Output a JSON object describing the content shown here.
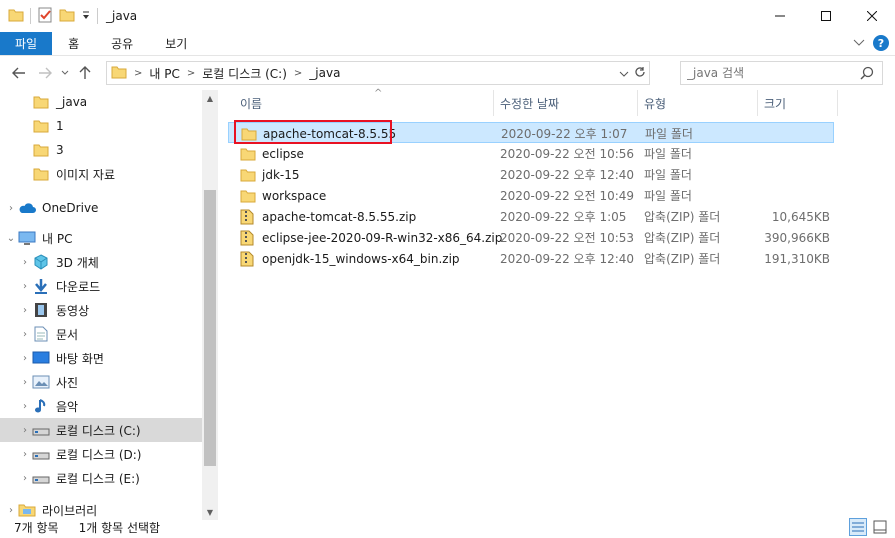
{
  "window": {
    "title": "_java"
  },
  "ribbon": {
    "tabs": [
      "파일",
      "홈",
      "공유",
      "보기"
    ]
  },
  "address": {
    "crumbs": [
      "내 PC",
      "로컬 디스크 (C:)",
      "_java"
    ]
  },
  "search": {
    "placeholder": "_java 검색"
  },
  "nav": {
    "items": [
      {
        "label": "_java",
        "icon": "folder-icon",
        "indent": 1,
        "expander": ""
      },
      {
        "label": "1",
        "icon": "folder-icon",
        "indent": 1,
        "expander": ""
      },
      {
        "label": "3",
        "icon": "folder-icon",
        "indent": 1,
        "expander": ""
      },
      {
        "label": "이미지 자료",
        "icon": "folder-icon",
        "indent": 1,
        "expander": ""
      },
      {
        "label": "OneDrive",
        "icon": "cloud-icon",
        "indent": 0,
        "expander": ">"
      },
      {
        "label": "내 PC",
        "icon": "computer-icon",
        "indent": 0,
        "expander": "v"
      },
      {
        "label": "3D 개체",
        "icon": "cube-icon",
        "indent": 1,
        "expander": ">"
      },
      {
        "label": "다운로드",
        "icon": "download-icon",
        "indent": 1,
        "expander": ">"
      },
      {
        "label": "동영상",
        "icon": "film-icon",
        "indent": 1,
        "expander": ">"
      },
      {
        "label": "문서",
        "icon": "document-icon",
        "indent": 1,
        "expander": ">"
      },
      {
        "label": "바탕 화면",
        "icon": "desktop-icon",
        "indent": 1,
        "expander": ">"
      },
      {
        "label": "사진",
        "icon": "picture-icon",
        "indent": 1,
        "expander": ">"
      },
      {
        "label": "음악",
        "icon": "music-icon",
        "indent": 1,
        "expander": ">"
      },
      {
        "label": "로컬 디스크 (C:)",
        "icon": "drive-icon",
        "indent": 1,
        "expander": ">",
        "selected": true
      },
      {
        "label": "로컬 디스크 (D:)",
        "icon": "drive-icon",
        "indent": 1,
        "expander": ">"
      },
      {
        "label": "로컬 디스크 (E:)",
        "icon": "drive-icon",
        "indent": 1,
        "expander": ">"
      },
      {
        "label": "라이브러리",
        "icon": "library-icon",
        "indent": 0,
        "expander": ">"
      }
    ]
  },
  "columns": {
    "name": "이름",
    "date": "수정한 날짜",
    "type": "유형",
    "size": "크기"
  },
  "files": [
    {
      "name": "apache-tomcat-8.5.55",
      "date": "2020-09-22 오후 1:07",
      "type": "파일 폴더",
      "size": "",
      "kind": "folder",
      "selected": true
    },
    {
      "name": "eclipse",
      "date": "2020-09-22 오전 10:56",
      "type": "파일 폴더",
      "size": "",
      "kind": "folder"
    },
    {
      "name": "jdk-15",
      "date": "2020-09-22 오후 12:40",
      "type": "파일 폴더",
      "size": "",
      "kind": "folder"
    },
    {
      "name": "workspace",
      "date": "2020-09-22 오전 10:49",
      "type": "파일 폴더",
      "size": "",
      "kind": "folder"
    },
    {
      "name": "apache-tomcat-8.5.55.zip",
      "date": "2020-09-22 오후 1:05",
      "type": "압축(ZIP) 폴더",
      "size": "10,645KB",
      "kind": "zip"
    },
    {
      "name": "eclipse-jee-2020-09-R-win32-x86_64.zip",
      "date": "2020-09-22 오전 10:53",
      "type": "압축(ZIP) 폴더",
      "size": "390,966KB",
      "kind": "zip"
    },
    {
      "name": "openjdk-15_windows-x64_bin.zip",
      "date": "2020-09-22 오후 12:40",
      "type": "압축(ZIP) 폴더",
      "size": "191,310KB",
      "kind": "zip"
    }
  ],
  "status": {
    "count": "7개 항목",
    "selected": "1개 항목 선택함"
  },
  "colors": {
    "accent": "#1979ca",
    "selection": "#cce8ff",
    "highlight": "#e81123",
    "folder": "#f8d775"
  }
}
